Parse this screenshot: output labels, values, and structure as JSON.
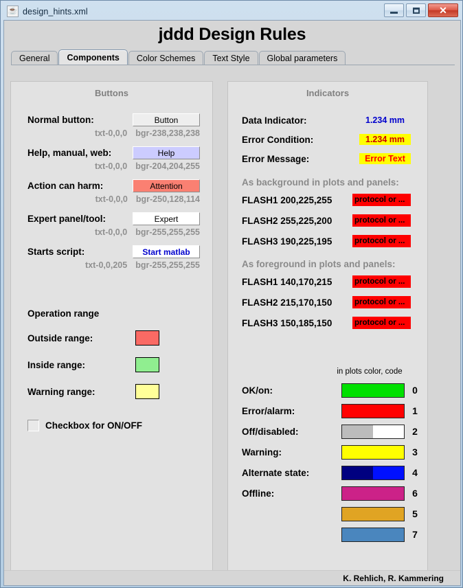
{
  "window": {
    "title": "design_hints.xml",
    "icon": "java-coffee-icon",
    "minimize_label": "–",
    "maximize_label": "□",
    "close_label": "✕"
  },
  "app": {
    "title": "jddd Design Rules",
    "footer": "K. Rehlich, R. Kammering"
  },
  "tabs": [
    {
      "label": "General",
      "active": false
    },
    {
      "label": "Components",
      "active": true
    },
    {
      "label": "Color Schemes",
      "active": false
    },
    {
      "label": "Text Style",
      "active": false
    },
    {
      "label": "Global parameters",
      "active": false
    }
  ],
  "buttons_panel": {
    "title": "Buttons",
    "rows": [
      {
        "label": "Normal button:",
        "button_label": "Button",
        "bg": "#eeeeee",
        "fg": "#000000",
        "txt_spec": "txt-0,0,0",
        "bgr_spec": "bgr-238,238,238"
      },
      {
        "label": "Help, manual, web:",
        "button_label": "Help",
        "bg": "#ccccff",
        "fg": "#000000",
        "txt_spec": "txt-0,0,0",
        "bgr_spec": "bgr-204,204,255"
      },
      {
        "label": "Action can harm:",
        "button_label": "Attention",
        "bg": "#fa8072",
        "fg": "#000000",
        "txt_spec": "txt-0,0,0",
        "bgr_spec": "bgr-250,128,114"
      },
      {
        "label": "Expert panel/tool:",
        "button_label": "Expert",
        "bg": "#ffffff",
        "fg": "#000000",
        "txt_spec": "txt-0,0,0",
        "bgr_spec": "bgr-255,255,255"
      },
      {
        "label": "Starts script:",
        "button_label": "Start matlab",
        "bg": "#ffffff",
        "fg": "#0000cd",
        "txt_spec": "txt-0,0,205",
        "bgr_spec": "bgr-255,255,255"
      }
    ],
    "operation_range_title": "Operation range",
    "ranges": [
      {
        "label": "Outside range:",
        "color": "#fa6a64"
      },
      {
        "label": "Inside range:",
        "color": "#90ee90"
      },
      {
        "label": "Warning range:",
        "color": "#ffff99"
      }
    ],
    "checkbox_label": "Checkbox for ON/OFF",
    "checkbox_checked": false
  },
  "indicators_panel": {
    "title": "Indicators",
    "rows": [
      {
        "label": "Data Indicator:",
        "value": "1.234 mm",
        "fg": "#0000cd",
        "bg": "transparent"
      },
      {
        "label": "Error Condition:",
        "value": "1.234 mm",
        "fg": "#cc0000",
        "bg": "#ffff00"
      },
      {
        "label": "Error Message:",
        "value": "Error Text",
        "fg": "#ff0000",
        "bg": "#ffff00"
      }
    ],
    "background_header": "As background in plots and panels:",
    "background_rows": [
      {
        "label": "FLASH1 200,225,255",
        "sample_text": "protocol or ...",
        "sample_bg": "#fe0000"
      },
      {
        "label": "FLASH2 255,225,200",
        "sample_text": "protocol or ...",
        "sample_bg": "#fe0000"
      },
      {
        "label": "FLASH3 190,225,195",
        "sample_text": "protocol or ...",
        "sample_bg": "#fe0000"
      }
    ],
    "foreground_header": "As foreground in plots and panels:",
    "foreground_rows": [
      {
        "label": "FLASH1 140,170,215",
        "sample_text": "protocol or ...",
        "sample_bg": "#fe0000"
      },
      {
        "label": "FLASH2 215,170,150",
        "sample_text": "protocol or ...",
        "sample_bg": "#fe0000"
      },
      {
        "label": "FLASH3 150,185,150",
        "sample_text": "protocol or ...",
        "sample_bg": "#fe0000"
      }
    ],
    "code_header": "in plots color, code",
    "code_rows": [
      {
        "label": "OK/on:",
        "code": "0",
        "colors": [
          "#00e000"
        ]
      },
      {
        "label": "Error/alarm:",
        "code": "1",
        "colors": [
          "#ff0000"
        ]
      },
      {
        "label": "Off/disabled:",
        "code": "2",
        "colors": [
          "#bcbcbc",
          "#ffffff"
        ]
      },
      {
        "label": "Warning:",
        "code": "3",
        "colors": [
          "#ffff00"
        ]
      },
      {
        "label": "Alternate state:",
        "code": "4",
        "colors": [
          "#000080",
          "#0010ff"
        ]
      },
      {
        "label": "Offline:",
        "code": "6",
        "colors": [
          "#cc2288"
        ]
      },
      {
        "label": "",
        "code": "5",
        "colors": [
          "#e0a423"
        ]
      },
      {
        "label": "",
        "code": "7",
        "colors": [
          "#4a86be"
        ]
      }
    ]
  }
}
